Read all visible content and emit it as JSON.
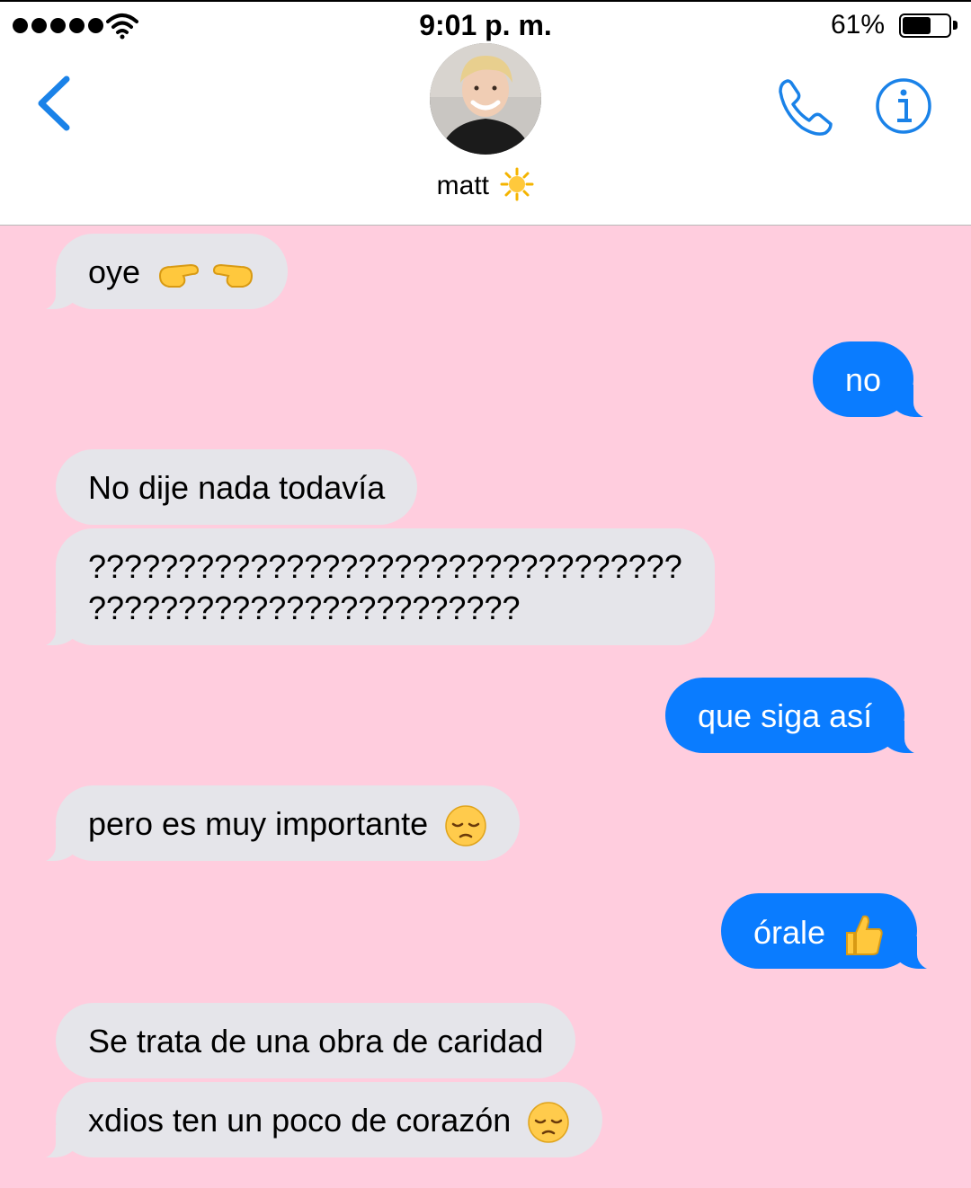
{
  "status": {
    "time": "9:01 p. m.",
    "battery_percent": "61%",
    "battery_level": 0.61
  },
  "header": {
    "contact_name": "matt",
    "contact_emoji_icon": "sun-emoji-icon"
  },
  "colors": {
    "chat_background": "#ffcdde",
    "incoming_bubble": "#e5e5ea",
    "outgoing_bubble": "#0a7cff",
    "accent": "#1a82e8"
  },
  "messages": [
    {
      "direction": "in",
      "text": "oye",
      "emoji": "pointing-hands-emoji-icon"
    },
    {
      "direction": "out",
      "text": "no"
    },
    {
      "direction": "in",
      "text": "No dije nada todavía"
    },
    {
      "direction": "in",
      "line1": "?????????????????????????????????",
      "line2": "????????????????????????"
    },
    {
      "direction": "out",
      "text": "que siga así"
    },
    {
      "direction": "in",
      "text": "pero es muy importante",
      "emoji": "pensive-face-emoji-icon"
    },
    {
      "direction": "out",
      "text": "órale",
      "emoji": "thumbs-up-emoji-icon"
    },
    {
      "direction": "in",
      "text": "Se trata de una obra de caridad"
    },
    {
      "direction": "in",
      "text": "xdios ten un poco de corazón",
      "emoji": "pensive-face-emoji-icon"
    }
  ]
}
